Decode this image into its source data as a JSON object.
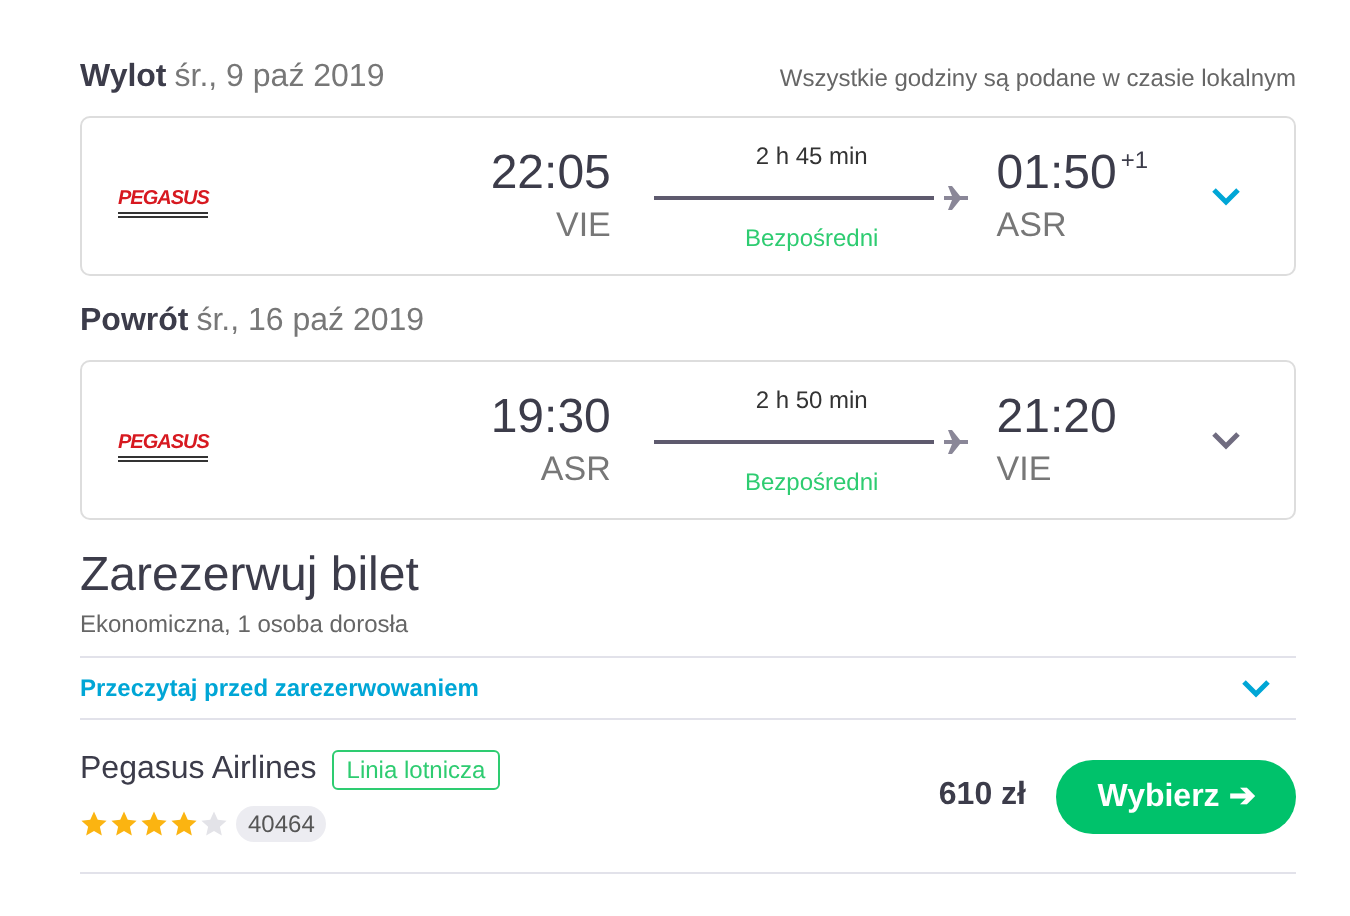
{
  "legs": [
    {
      "label": "Wylot",
      "date": "śr., 9 paź 2019",
      "note": "Wszystkie godziny są podane w czasie lokalnym",
      "logo": "PEGASUS",
      "depart_time": "22:05",
      "depart_code": "VIE",
      "duration": "2 h 45 min",
      "stops": "Bezpośredni",
      "arrive_time": "01:50",
      "day_offset": "+1",
      "arrive_code": "ASR",
      "active": true
    },
    {
      "label": "Powrót",
      "date": "śr., 16 paź 2019",
      "logo": "PEGASUS",
      "depart_time": "19:30",
      "depart_code": "ASR",
      "duration": "2 h 50 min",
      "stops": "Bezpośredni",
      "arrive_time": "21:20",
      "arrive_code": "VIE",
      "active": false
    }
  ],
  "booking": {
    "title": "Zarezerwuj bilet",
    "subtitle": "Ekonomiczna, 1 osoba dorosła",
    "info_link": "Przeczytaj przed zarezerwowaniem",
    "offer": {
      "provider": "Pegasus Airlines",
      "tag": "Linia lotnicza",
      "stars": 4,
      "reviews": "40464",
      "price": "610 zł",
      "button": "Wybierz ➔"
    }
  }
}
